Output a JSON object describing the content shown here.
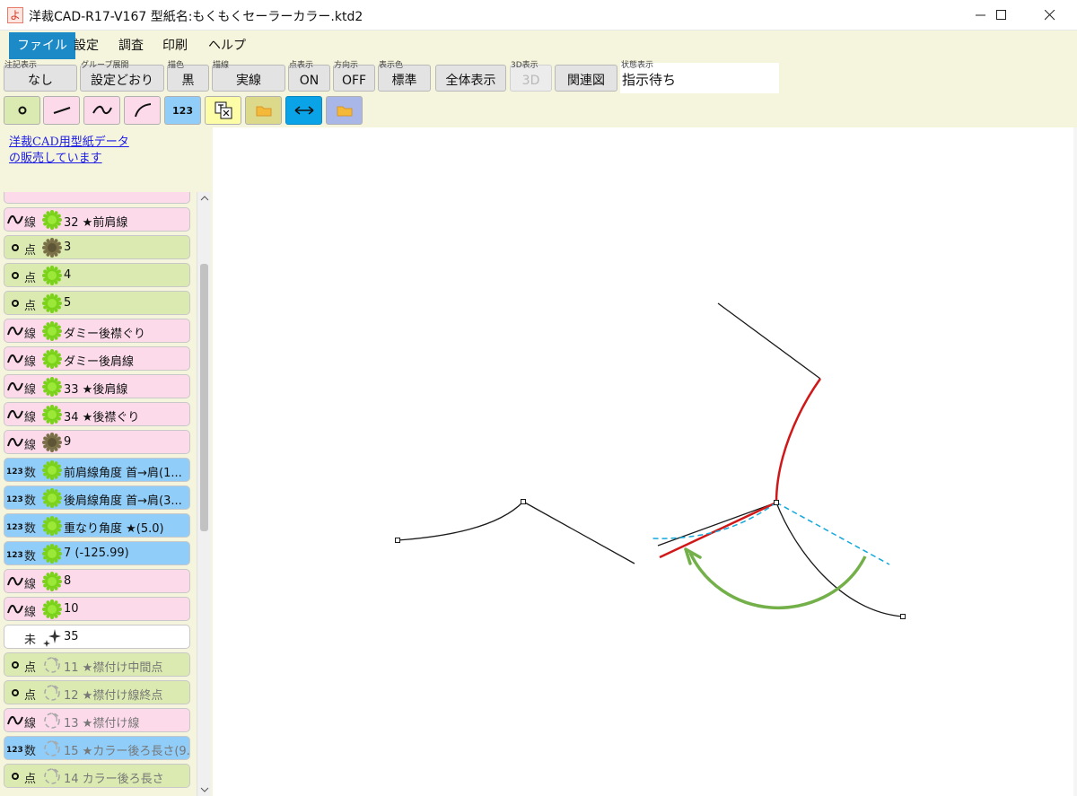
{
  "window": {
    "app_icon": "よ",
    "title": "洋裁CAD-R17-V167 型紙名:もくもくセーラーカラー.ktd2"
  },
  "menu": [
    "ファイル",
    "設定",
    "調査",
    "印刷",
    "ヘルプ"
  ],
  "toolbar": {
    "annotation": {
      "caption": "注記表示",
      "value": "なし"
    },
    "group_expand": {
      "caption": "グループ展開",
      "value": "設定どおり"
    },
    "draw_color": {
      "caption": "描色",
      "value": "黒"
    },
    "draw_line": {
      "caption": "描線",
      "value": "実線"
    },
    "point_display": {
      "caption": "点表示",
      "value": "ON"
    },
    "direction": {
      "caption": "方向示",
      "value": "OFF"
    },
    "display_color": {
      "caption": "表示色",
      "value": "標準"
    },
    "fit_all": "全体表示",
    "view_3d": {
      "caption": "3D表示",
      "value": "3D"
    },
    "relation": "関連図",
    "status": {
      "caption": "状態表示",
      "value": "指示待ち"
    }
  },
  "icon_row": {
    "num_icon_text": "123",
    "colors": {
      "point": "#dbeab0",
      "line": "#fcdaea",
      "num": "#90cdf9",
      "yellow": "#fdfda8",
      "olive": "#dcd98a",
      "arrow_blue": "#0aa3e8",
      "lavender": "#a9b6e8"
    }
  },
  "sidebar": {
    "ad_line1": "洋裁CAD用型紙データ",
    "ad_line2": "の販売しています",
    "items": [
      {
        "kind": "line",
        "type": "線",
        "gear": "green",
        "label": "32 ★前肩線"
      },
      {
        "kind": "point",
        "type": "点",
        "gear": "olive",
        "label": "3"
      },
      {
        "kind": "point",
        "type": "点",
        "gear": "green",
        "label": "4"
      },
      {
        "kind": "point",
        "type": "点",
        "gear": "green",
        "label": "5"
      },
      {
        "kind": "line",
        "type": "線",
        "gear": "green",
        "label": "ダミー後襟ぐり"
      },
      {
        "kind": "line",
        "type": "線",
        "gear": "green",
        "label": "ダミー後肩線"
      },
      {
        "kind": "line",
        "type": "線",
        "gear": "green",
        "label": "33 ★後肩線"
      },
      {
        "kind": "line",
        "type": "線",
        "gear": "green",
        "label": "34 ★後襟ぐり"
      },
      {
        "kind": "line",
        "type": "線",
        "gear": "olive",
        "label": "9"
      },
      {
        "kind": "num",
        "type": "数",
        "gear": "green",
        "label": "前肩線角度 首→肩(1..."
      },
      {
        "kind": "num",
        "type": "数",
        "gear": "green",
        "label": "後肩線角度 首→肩(3..."
      },
      {
        "kind": "num",
        "type": "数",
        "gear": "green",
        "label": "重なり角度 ★(5.0)"
      },
      {
        "kind": "num",
        "type": "数",
        "gear": "green",
        "label": "7 (-125.99)"
      },
      {
        "kind": "line",
        "type": "線",
        "gear": "green",
        "label": "8"
      },
      {
        "kind": "line",
        "type": "線",
        "gear": "green",
        "label": "10"
      },
      {
        "kind": "none",
        "type": "未",
        "gear": "sparkle",
        "label": "35"
      },
      {
        "kind": "point",
        "type": "点",
        "gear": "outline",
        "label": "11 ★襟付け中間点"
      },
      {
        "kind": "point",
        "type": "点",
        "gear": "outline",
        "label": "12 ★襟付け線終点"
      },
      {
        "kind": "line",
        "type": "線",
        "gear": "outline",
        "label": "13 ★襟付け線"
      },
      {
        "kind": "num",
        "type": "数",
        "gear": "outline",
        "label": "15 ★カラー後ろ長さ(9..."
      },
      {
        "kind": "point",
        "type": "点",
        "gear": "outline",
        "label": "14 カラー後ろ長さ"
      }
    ]
  },
  "drawing": {
    "colors": {
      "black": "#1a1a1a",
      "red": "#d01818",
      "dashed": "#12a8dc",
      "arc": "#74b04a"
    }
  }
}
